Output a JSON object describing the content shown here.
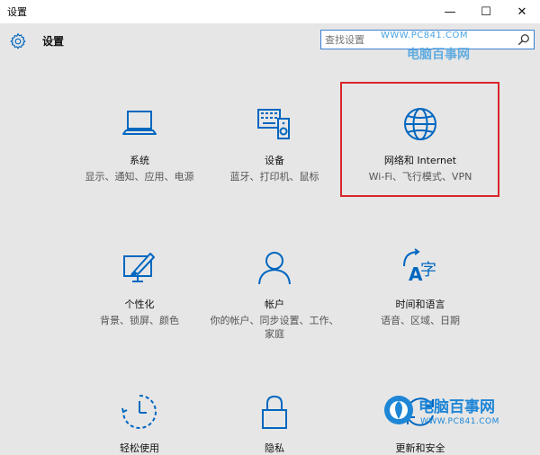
{
  "window": {
    "title": "设置",
    "minimize": "—",
    "maximize": "☐",
    "close": "✕"
  },
  "header": {
    "heading": "设置"
  },
  "search": {
    "placeholder": "查找设置"
  },
  "watermark_top": {
    "url": "WWW.PC841.COM",
    "brand": "电脑百事网"
  },
  "tiles": [
    {
      "name": "系统",
      "desc": "显示、通知、应用、电源",
      "icon": "laptop-icon"
    },
    {
      "name": "设备",
      "desc": "蓝牙、打印机、鼠标",
      "icon": "keyboard-speaker-icon"
    },
    {
      "name": "网络和 Internet",
      "desc": "Wi-Fi、飞行模式、VPN",
      "icon": "globe-icon"
    },
    {
      "name": "个性化",
      "desc": "背景、锁屏、颜色",
      "icon": "paint-monitor-icon"
    },
    {
      "name": "帐户",
      "desc": "你的帐户、同步设置、工作、家庭",
      "icon": "person-icon"
    },
    {
      "name": "时间和语言",
      "desc": "语音、区域、日期",
      "icon": "time-language-icon"
    },
    {
      "name": "轻松使用",
      "desc": "",
      "icon": "ease-of-access-icon"
    },
    {
      "name": "隐私",
      "desc": "",
      "icon": "lock-icon"
    },
    {
      "name": "更新和安全",
      "desc": "",
      "icon": "update-icon"
    }
  ],
  "watermark_bottom": {
    "brand": "电脑百事网",
    "url": "WWW.PC841.COM"
  },
  "colors": {
    "accent": "#0067c0",
    "highlight": "#d7262b",
    "background": "#e6e6e6"
  }
}
